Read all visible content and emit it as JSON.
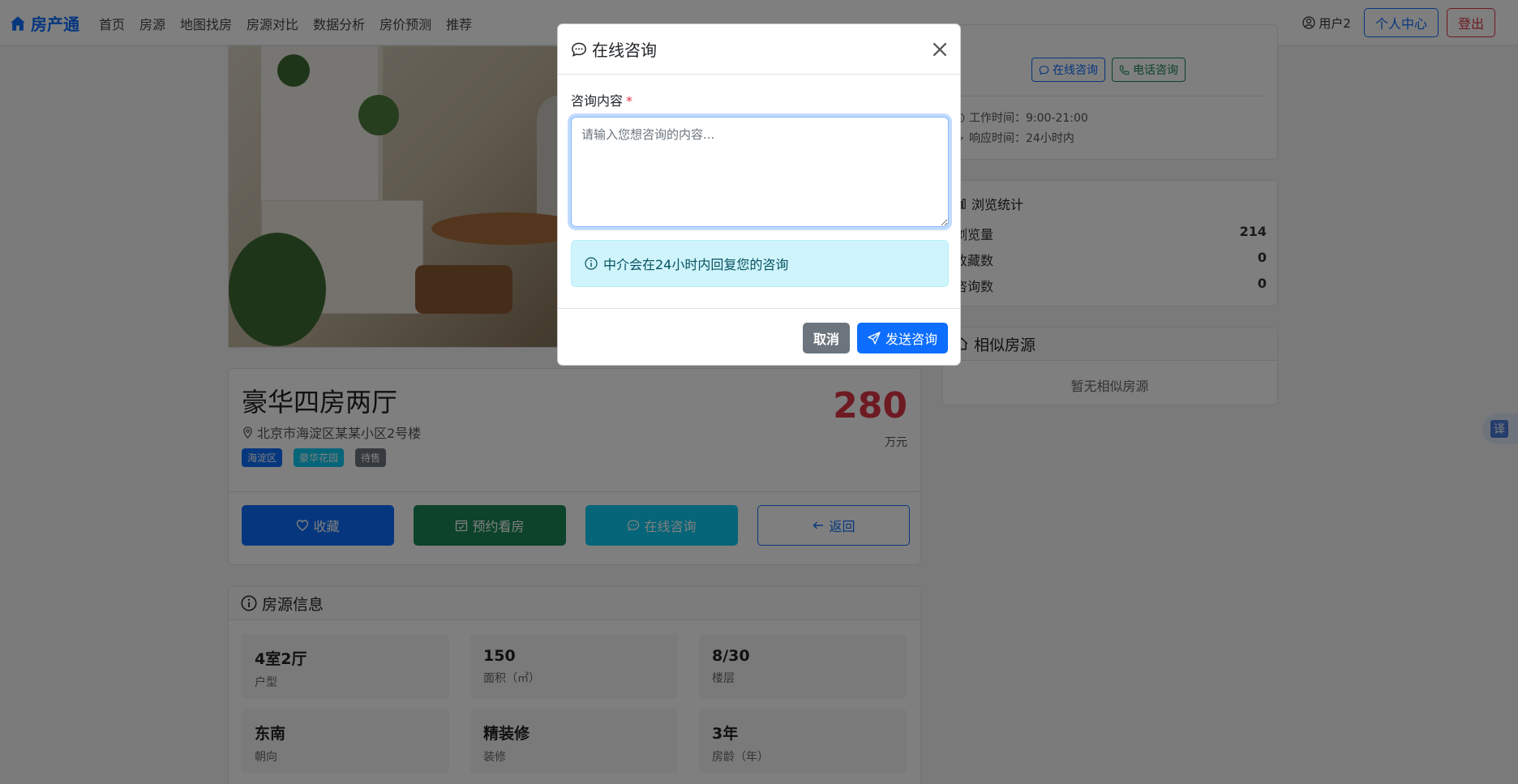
{
  "navbar": {
    "brand": "房产通",
    "links": [
      "首页",
      "房源",
      "地图找房",
      "房源对比",
      "数据分析",
      "房价预测",
      "推荐"
    ],
    "user": "用户2",
    "profile_button": "个人中心",
    "logout_button": "登出"
  },
  "listing": {
    "title": "豪华四房两厅",
    "address": "北京市海淀区某某小区2号楼",
    "badges": [
      {
        "label": "海淀区",
        "color": "#0d6efd"
      },
      {
        "label": "豪华花园",
        "color": "#0dcaf0"
      },
      {
        "label": "待售",
        "color": "#6c757d"
      }
    ],
    "price": "280",
    "price_unit": "万元",
    "actions": {
      "favorite": "收藏",
      "appointment": "预约看房",
      "consult": "在线咨询",
      "back": "返回"
    }
  },
  "house_info": {
    "header": "房源信息",
    "items": [
      {
        "value": "4室2厅",
        "label": "户型"
      },
      {
        "value": "150",
        "label": "面积（㎡）"
      },
      {
        "value": "8/30",
        "label": "楼层"
      },
      {
        "value": "东南",
        "label": "朝向"
      },
      {
        "value": "精装修",
        "label": "装修"
      },
      {
        "value": "3年",
        "label": "房龄（年）"
      }
    ]
  },
  "agent": {
    "online_button": "在线咨询",
    "phone_button": "电话咨询",
    "work_time": "工作时间：9:00-21:00",
    "response_time": "响应时间：24小时内"
  },
  "stats": {
    "header": "浏览统计",
    "rows": [
      {
        "label": "浏览量",
        "value": "214"
      },
      {
        "label": "收藏数",
        "value": "0"
      },
      {
        "label": "咨询数",
        "value": "0"
      }
    ]
  },
  "similar": {
    "header": "相似房源",
    "empty": "暂无相似房源"
  },
  "translate": "译",
  "modal": {
    "title": "在线咨询",
    "field_label": "咨询内容",
    "required_mark": "*",
    "placeholder": "请输入您想咨询的内容...",
    "alert": "中介会在24小时内回复您的咨询",
    "cancel": "取消",
    "submit": "发送咨询"
  },
  "colors": {
    "primary": "#0d6efd",
    "success": "#198754",
    "info": "#0dcaf0",
    "danger": "#dc3545",
    "secondary": "#6c757d"
  }
}
